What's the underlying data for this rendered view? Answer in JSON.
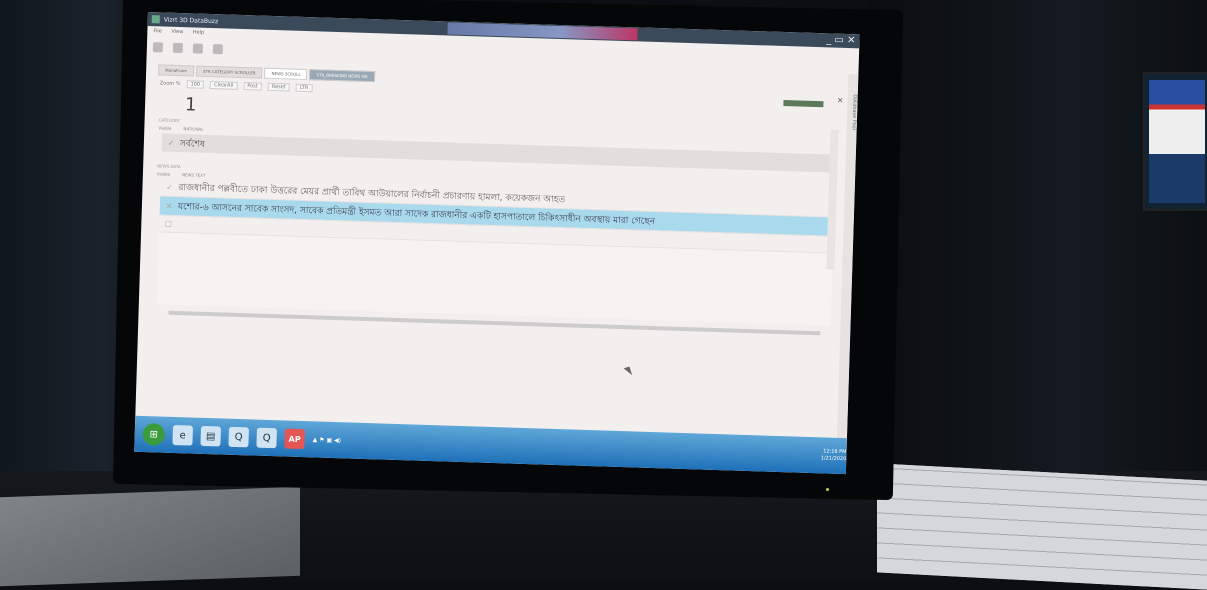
{
  "window": {
    "title": "Vizrt 3D DataBuzz",
    "controls": "_ ▭ ✕"
  },
  "menu": [
    "File",
    "View",
    "Help"
  ],
  "tabs": [
    {
      "label": "ManaFcom",
      "state": "normal"
    },
    {
      "label": "STR CATEGORY SCROLLER",
      "state": "normal"
    },
    {
      "label": "NEWS SCROLL",
      "state": "active"
    },
    {
      "label": "STR_BREAKING NEWS HD",
      "state": "dark"
    }
  ],
  "zoom_row": {
    "zoom_label": "Zoom %",
    "zoom_value": "100",
    "buttons": [
      "ClearAll",
      "Post",
      "Reset",
      "LTR"
    ]
  },
  "page_number": "1",
  "category": {
    "section_label": "CATEGORY",
    "columns": [
      "Visible",
      "NATIONAL"
    ],
    "row_mark": "✓",
    "row_text": "সর্বশেষ"
  },
  "news": {
    "section_label": "NEWS DATA",
    "columns": [
      "Visible",
      "NEWS TEXT"
    ],
    "rows": [
      {
        "mark": "✓",
        "text": "রাজধানীর পল্লবীতে ঢাকা উত্তরের মেয়র প্রার্থী তাবিথ আউয়ালের নির্বাচনী প্রচারণায় হামলা, কয়েকজন আহত"
      },
      {
        "mark": "✕",
        "text": "যশোর-৬ আসনের সাবেক সাংসদ, সাবেক প্রতিমন্ত্রী ইসমত আরা সাদেক রাজধানীর একটি হাসপাতালে চিকিৎসাধীন অবস্থায় মারা গেছেন"
      },
      {
        "mark": "☐",
        "text": ""
      }
    ]
  },
  "side_panel": {
    "label": "Database Pool",
    "close": "×"
  },
  "taskbar": {
    "icons": [
      {
        "name": "start-orb",
        "glyph": "⊞"
      },
      {
        "name": "ie-icon",
        "glyph": "e"
      },
      {
        "name": "folder-icon",
        "glyph": "▤"
      },
      {
        "name": "app-q-icon",
        "glyph": "Q"
      },
      {
        "name": "app-q2-icon",
        "glyph": "Q"
      },
      {
        "name": "ap-icon",
        "glyph": "AP"
      }
    ],
    "tray": "▲ ⚑ ▣ ◀)",
    "time": "12:16 PM",
    "date": "1/21/2020"
  }
}
